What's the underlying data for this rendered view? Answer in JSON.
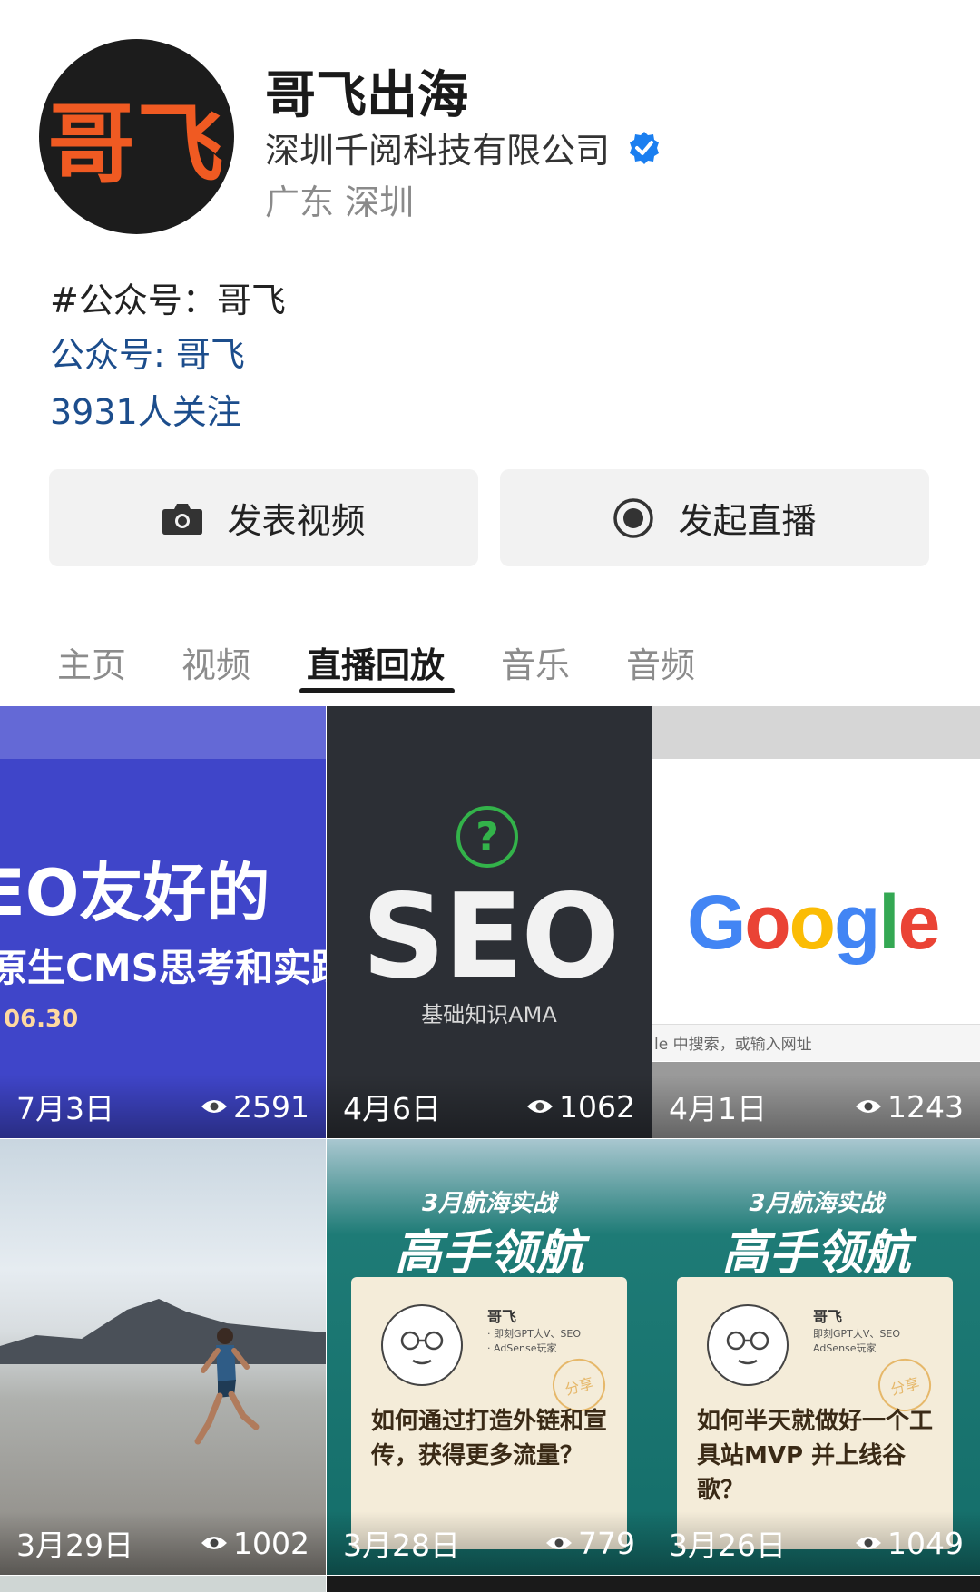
{
  "profile": {
    "avatar_text": "哥飞",
    "name": "哥飞出海",
    "company": "深圳千阅科技有限公司",
    "location": "广东 深圳",
    "bio_tag": "#公众号：哥飞",
    "bio_link": "公众号: 哥飞",
    "followers": "3931人关注"
  },
  "actions": {
    "publish_video": "发表视频",
    "start_live": "发起直播"
  },
  "tabs": [
    {
      "label": "主页",
      "active": false
    },
    {
      "label": "视频",
      "active": false
    },
    {
      "label": "直播回放",
      "active": true
    },
    {
      "label": "音乐",
      "active": false
    },
    {
      "label": "音频",
      "active": false
    }
  ],
  "replays": [
    {
      "date": "7月3日",
      "views": "2591",
      "cover": {
        "headline": "EO友好的",
        "subline": "原生CMS思考和实践",
        "date_text": "06.30"
      }
    },
    {
      "date": "4月6日",
      "views": "1062",
      "cover": {
        "icon_text": "?",
        "headline": "SEO",
        "subline": "基础知识AMA"
      }
    },
    {
      "date": "4月1日",
      "views": "1243",
      "cover": {
        "logo_letters": [
          "G",
          "o",
          "o",
          "g",
          "l",
          "e"
        ],
        "search_hint": "le 中搜索，或输入网址"
      }
    },
    {
      "date": "3月29日",
      "views": "1002",
      "cover": {}
    },
    {
      "date": "3月28日",
      "views": "779",
      "cover": {
        "kicker": "3月航海实战",
        "headline": "高手领航",
        "author": "哥飞",
        "creds": [
          "· 即刻GPT大V、SEO",
          "· AdSense玩家"
        ],
        "stamp": "分享",
        "question": "如何通过打造外链和宣传，获得更多流量？"
      }
    },
    {
      "date": "3月26日",
      "views": "1049",
      "cover": {
        "kicker": "3月航海实战",
        "headline": "高手领航",
        "author": "哥飞",
        "creds": [
          "即刻GPT大V、SEO",
          "AdSense玩家"
        ],
        "stamp": "分享",
        "question": "如何半天就做好一个工具站MVP 并上线谷歌？"
      }
    }
  ],
  "colors": {
    "link_blue": "#1c4d8c",
    "verified_blue": "#1b7ff0",
    "avatar_orange": "#f05a22",
    "google": [
      "#4285F4",
      "#EA4335",
      "#FBBC05",
      "#4285F4",
      "#34A853",
      "#EA4335"
    ]
  }
}
